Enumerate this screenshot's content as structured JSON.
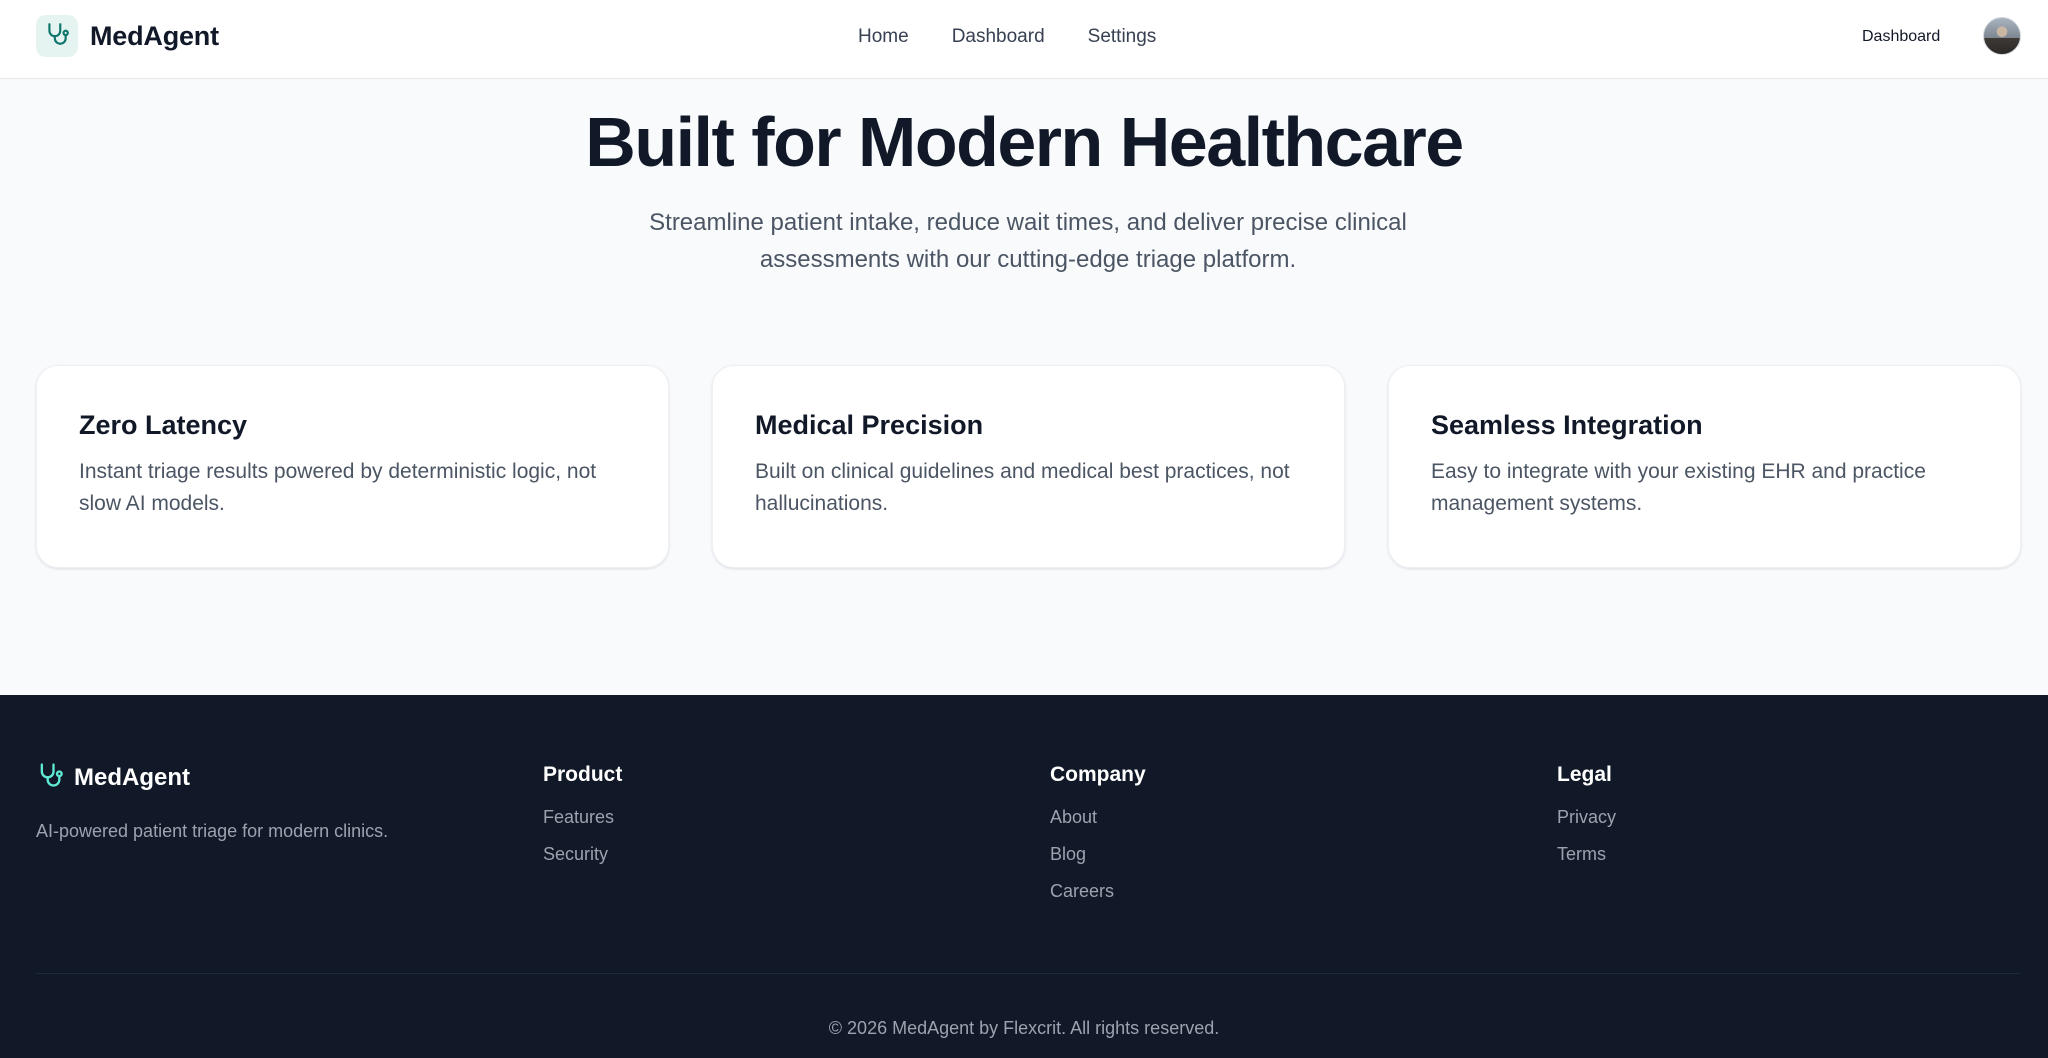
{
  "colors": {
    "accent": "#0f766e",
    "accent_light": "#5eead4",
    "footer_bg": "#111827",
    "page_bg": "#f8fafc"
  },
  "nav": {
    "brand_icon": "stethoscope-icon",
    "brand_name": "MedAgent",
    "links": [
      "Home",
      "Dashboard",
      "Settings"
    ],
    "right_link": "Dashboard",
    "avatar_icon": "user-avatar"
  },
  "hero": {
    "title": "Built for Modern Healthcare",
    "subtitle": "Streamline patient intake, reduce wait times, and deliver precise clinical assessments with our cutting-edge triage platform."
  },
  "features": [
    {
      "title": "Zero Latency",
      "text": "Instant triage results powered by deterministic logic, not slow AI models."
    },
    {
      "title": "Medical Precision",
      "text": "Built on clinical guidelines and medical best practices, not hallucinations."
    },
    {
      "title": "Seamless Integration",
      "text": "Easy to integrate with your existing EHR and practice management systems."
    }
  ],
  "footer": {
    "brand_icon": "stethoscope-icon",
    "brand_name": "MedAgent",
    "tagline": "AI-powered patient triage for modern clinics.",
    "columns": [
      {
        "title": "Product",
        "links": [
          "Features",
          "Security"
        ]
      },
      {
        "title": "Company",
        "links": [
          "About",
          "Blog",
          "Careers"
        ]
      },
      {
        "title": "Legal",
        "links": [
          "Privacy",
          "Terms"
        ]
      }
    ],
    "copyright": "© 2026 MedAgent by Flexcrit. All rights reserved."
  }
}
